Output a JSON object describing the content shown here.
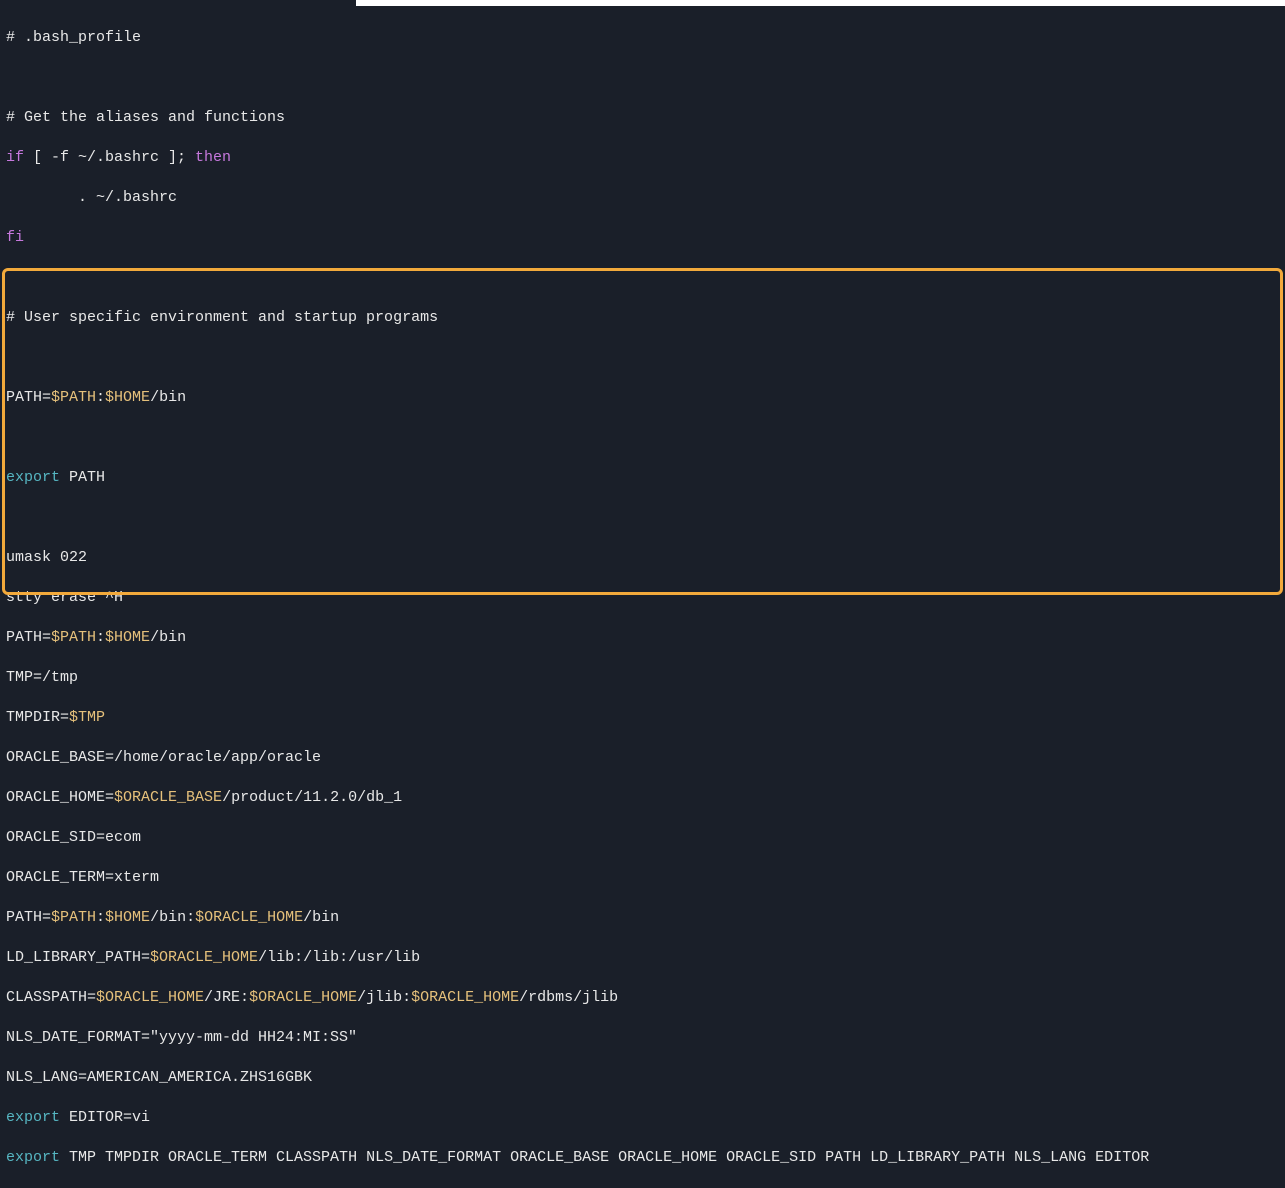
{
  "file": ".bash_profile",
  "lines": {
    "l01": "# .bash_profile",
    "l02": "",
    "l03": "# Get the aliases and functions",
    "l04a": "if",
    "l04b": " [ -f ~/.bashrc ]; ",
    "l04c": "then",
    "l05": "        . ~/.bashrc",
    "l06": "fi",
    "l07": "",
    "l08": "# User specific environment and startup programs",
    "l09": "",
    "l10a": "PATH=",
    "l10b": "$PATH",
    "l10c": ":",
    "l10d": "$HOME",
    "l10e": "/bin",
    "l11": "",
    "l12a": "export",
    "l12b": " PATH",
    "l13": "",
    "l14": "umask 022",
    "l15": "stty erase ^H",
    "l16a": "PATH=",
    "l16b": "$PATH",
    "l16c": ":",
    "l16d": "$HOME",
    "l16e": "/bin",
    "l17": "TMP=/tmp",
    "l18a": "TMPDIR=",
    "l18b": "$TMP",
    "l19": "ORACLE_BASE=/home/oracle/app/oracle",
    "l20a": "ORACLE_HOME=",
    "l20b": "$ORACLE_BASE",
    "l20c": "/product/11.2.0/db_1",
    "l21": "ORACLE_SID=ecom",
    "l22": "ORACLE_TERM=xterm",
    "l23a": "PATH=",
    "l23b": "$PATH",
    "l23c": ":",
    "l23d": "$HOME",
    "l23e": "/bin:",
    "l23f": "$ORACLE_HOME",
    "l23g": "/bin",
    "l24a": "LD_LIBRARY_PATH=",
    "l24b": "$ORACLE_HOME",
    "l24c": "/lib:/lib:/usr/lib",
    "l25a": "CLASSPATH=",
    "l25b": "$ORACLE_HOME",
    "l25c": "/JRE:",
    "l25d": "$ORACLE_HOME",
    "l25e": "/jlib:",
    "l25f": "$ORACLE_HOME",
    "l25g": "/rdbms/jlib",
    "l26": "NLS_DATE_FORMAT=\"yyyy-mm-dd HH24:MI:SS\"",
    "l27": "NLS_LANG=AMERICAN_AMERICA.ZHS16GBK",
    "l28a": "export",
    "l28b": " EDITOR=vi",
    "l29a": "export",
    "l29b": " TMP TMPDIR ORACLE_TERM CLASSPATH NLS_DATE_FORMAT ORACLE_BASE ORACLE_HOME ORACLE_SID PATH LD_LIBRARY_PATH NLS_LANG EDITOR"
  }
}
